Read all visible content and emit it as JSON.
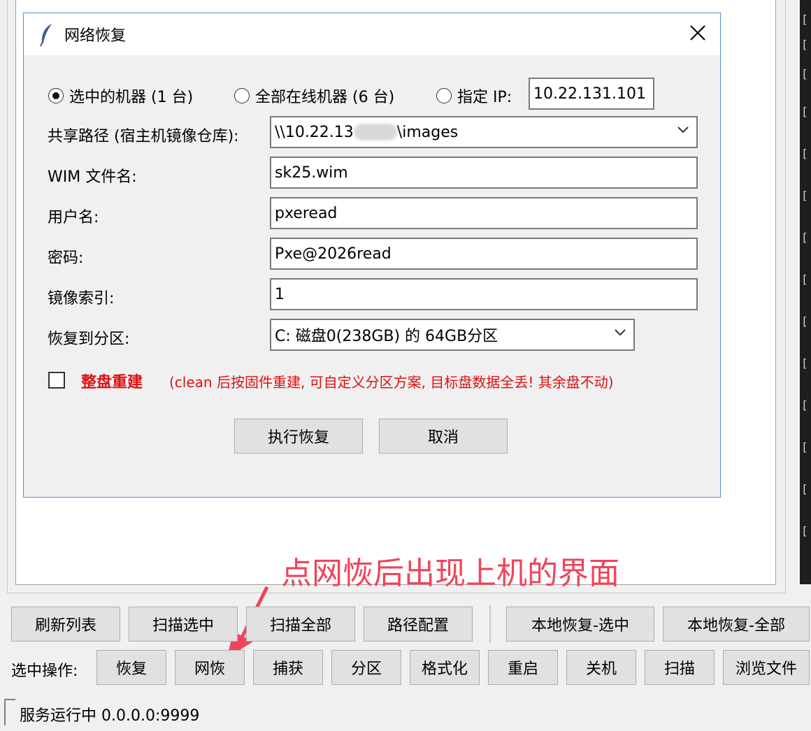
{
  "dialog": {
    "title": "网络恢复",
    "radios": [
      {
        "label": "选中的机器 (1 台)",
        "selected": true
      },
      {
        "label": "全部在线机器 (6 台)",
        "selected": false
      },
      {
        "label": "指定 IP:",
        "selected": false
      }
    ],
    "ip_value": "10.22.131.101",
    "fields": {
      "share_path_label": "共享路径 (宿主机镜像仓库):",
      "share_path_prefix": "\\\\10.22.13",
      "share_path_suffix": "\\images",
      "wim_label": "WIM 文件名:",
      "wim_value": "sk25.wim",
      "user_label": "用户名:",
      "user_value": "pxeread",
      "password_label": "密码:",
      "password_value": "Pxe@2026read",
      "index_label": "镜像索引:",
      "index_value": "1",
      "partition_label": "恢复到分区:",
      "partition_value": "C:  磁盘0(238GB) 的 64GB分区"
    },
    "rebuild_label": "整盘重建",
    "rebuild_note": "(clean 后按固件重建, 可自定义分区方案, 目标盘数据全丢! 其余盘不动)",
    "execute_label": "执行恢复",
    "cancel_label": "取消"
  },
  "annotation": "点网恢后出现上机的界面",
  "toolbar_top": [
    "刷新列表",
    "扫描选中",
    "扫描全部",
    "路径配置",
    "本地恢复-选中",
    "本地恢复-全部"
  ],
  "ops_label": "选中操作:",
  "toolbar_ops": [
    "恢复",
    "网恢",
    "捕获",
    "分区",
    "格式化",
    "重启",
    "关机",
    "扫描",
    "浏览文件"
  ],
  "status": "服务运行中 0.0.0.0:9999",
  "colors": {
    "accent": "#4a90d9",
    "warning": "#e01010",
    "annotation": "#f0445a"
  }
}
